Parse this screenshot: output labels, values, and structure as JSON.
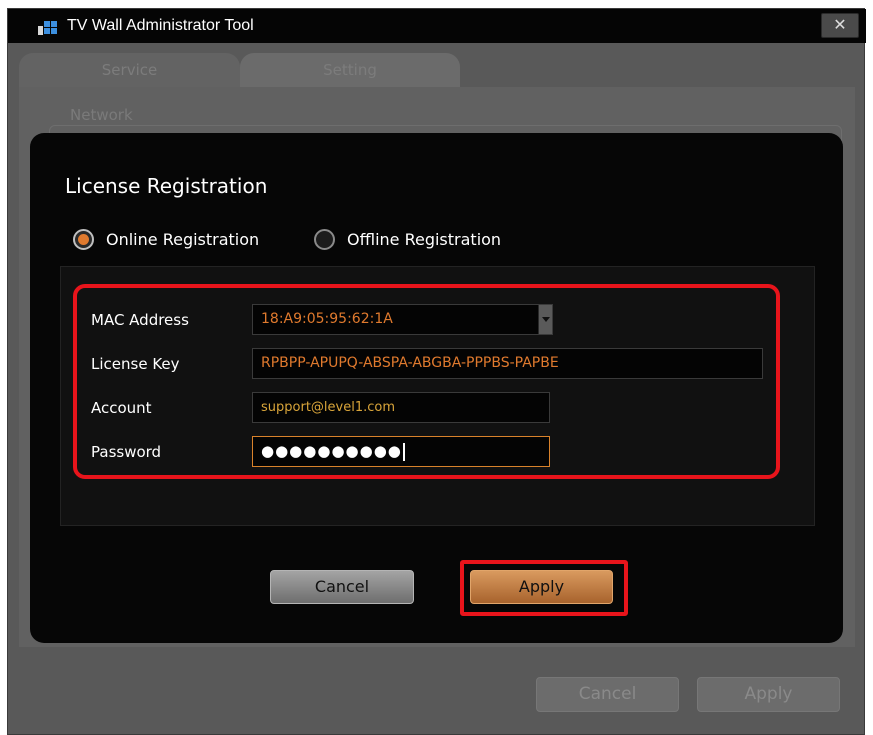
{
  "window": {
    "title": "TV Wall Administrator Tool",
    "app_icon": "monitor-grid-icon",
    "close_glyph": "✕"
  },
  "tabs": [
    {
      "label": "Service",
      "active": true
    },
    {
      "label": "Setting",
      "active": false
    }
  ],
  "group": {
    "label": "Network"
  },
  "background_buttons": {
    "cancel_label": "Cancel",
    "apply_label": "Apply"
  },
  "dialog": {
    "title": "License Registration",
    "registration_mode": {
      "options": [
        "Online Registration",
        "Offline Registration"
      ],
      "selected": "Online Registration"
    },
    "fields": {
      "mac_label": "MAC Address",
      "mac_value": "18:A9:05:95:62:1A",
      "key_label": "License Key",
      "key_value": "RPBPP-APUPQ-ABSPA-ABGBA-PPPBS-PAPBE",
      "account_label": "Account",
      "account_value": "support@level1.com",
      "password_label": "Password",
      "password_value": "●●●●●●●●●●"
    },
    "buttons": {
      "cancel_label": "Cancel",
      "apply_label": "Apply"
    }
  },
  "colors": {
    "accent_orange": "#e07a2e",
    "highlight_red": "#e8141b",
    "dialog_bg": "#060606",
    "window_bg": "#595959"
  }
}
